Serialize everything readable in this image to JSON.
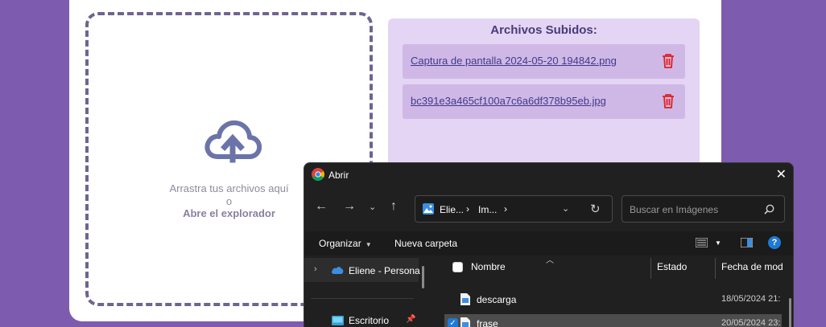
{
  "dropzone": {
    "line1": "Arrastra tus archivos aquí",
    "line2": "o",
    "line3": "Abre el explorador",
    "icon": "cloud-upload-icon"
  },
  "uploaded": {
    "title": "Archivos Subidos:",
    "files": [
      {
        "name": "Captura de pantalla 2024-05-20 194842.png"
      },
      {
        "name": "bc391e3a465cf100a7c6a6df378b95eb.jpg"
      }
    ]
  },
  "dialog": {
    "title": "Abrir",
    "address": [
      "Elie...",
      "Im..."
    ],
    "search_placeholder": "Buscar en Imágenes",
    "commands": {
      "organize": "Organizar",
      "new_folder": "Nueva carpeta"
    },
    "nav": [
      {
        "label": "Eliene - Persona"
      },
      {
        "label": "Escritorio"
      }
    ],
    "columns": {
      "name": "Nombre",
      "status": "Estado",
      "date": "Fecha de mod"
    },
    "files": [
      {
        "name": "descarga",
        "date": "18/05/2024 21:",
        "selected": false
      },
      {
        "name": "frase",
        "date": "20/05/2024 23:",
        "selected": true
      }
    ]
  },
  "colors": {
    "background": "#7d5bae",
    "panel": "#e3d5f3",
    "file_row": "#d0b8e6",
    "trash": "#e02020",
    "dialog": "#202020",
    "accent": "#1e7ad6"
  }
}
